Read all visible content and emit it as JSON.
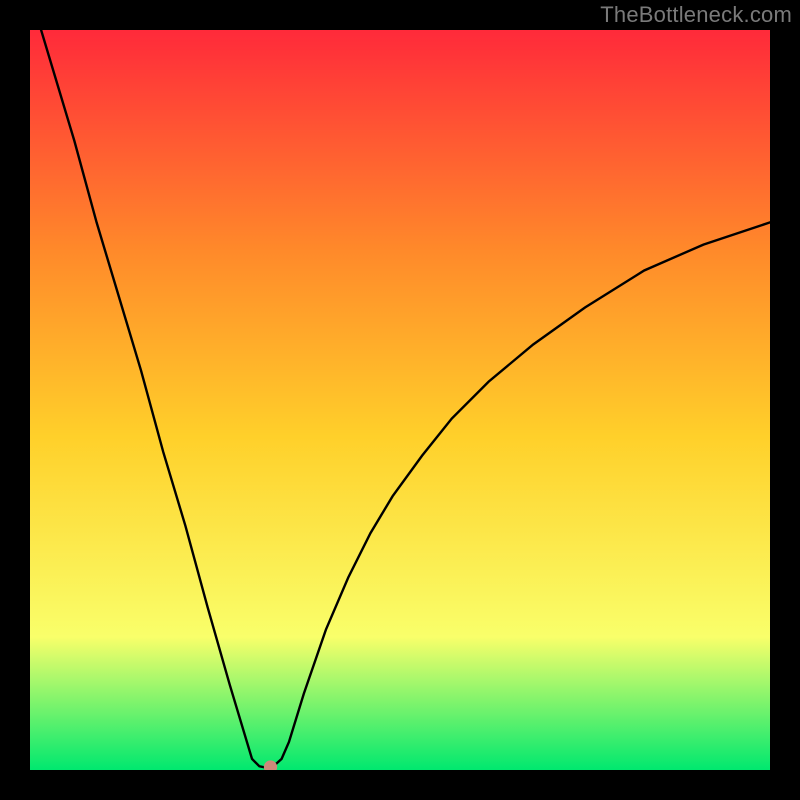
{
  "watermark": "TheBottleneck.com",
  "chart_data": {
    "type": "line",
    "title": "",
    "xlabel": "",
    "ylabel": "",
    "xlim": [
      0,
      100
    ],
    "ylim": [
      0,
      100
    ],
    "grid": false,
    "legend": false,
    "background_gradient": {
      "top": "#ff2a3a",
      "middle_upper": "#ff8a2a",
      "middle": "#ffd02a",
      "lower": "#f9ff6a",
      "bottom": "#00e86f"
    },
    "series": [
      {
        "name": "curve",
        "color": "#000000",
        "x": [
          0,
          3,
          6,
          9,
          12,
          15,
          18,
          21,
          24,
          27,
          30,
          31,
          32,
          33,
          34,
          35,
          37,
          40,
          43,
          46,
          49,
          53,
          57,
          62,
          68,
          75,
          83,
          91,
          100
        ],
        "y": [
          105,
          95,
          85,
          74,
          64,
          54,
          43,
          33,
          22,
          11.5,
          1.5,
          0.5,
          0.3,
          0.6,
          1.5,
          3.8,
          10.3,
          19,
          26,
          32,
          37,
          42.5,
          47.5,
          52.5,
          57.5,
          62.5,
          67.5,
          71,
          74
        ]
      }
    ],
    "marker": {
      "x": 32.5,
      "y": 0.4,
      "color": "#cc8a7a",
      "radius_pct": 0.9
    }
  }
}
